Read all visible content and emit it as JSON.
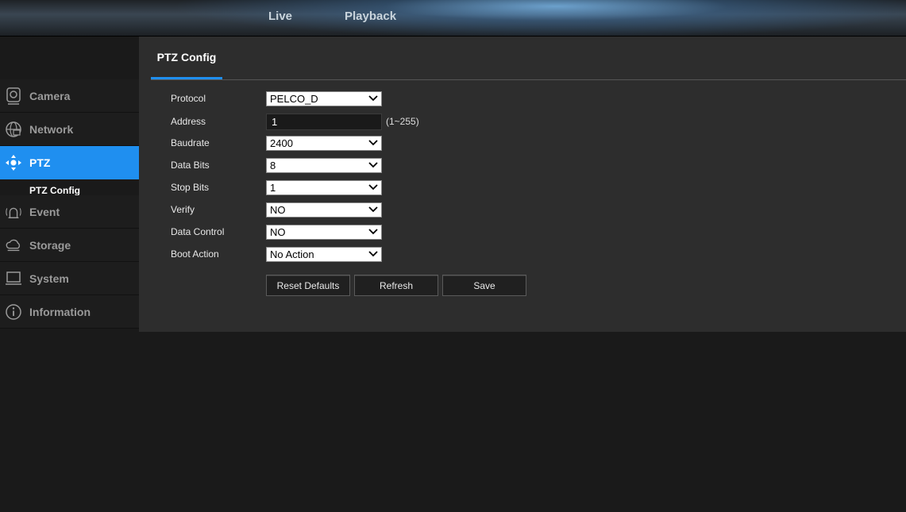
{
  "topnav": {
    "live": "Live",
    "playback": "Playback"
  },
  "sidebar": {
    "items": [
      {
        "label": "Camera",
        "icon": "camera-icon"
      },
      {
        "label": "Network",
        "icon": "network-icon"
      },
      {
        "label": "PTZ",
        "icon": "ptz-icon",
        "active": true
      },
      {
        "label": "Event",
        "icon": "event-icon"
      },
      {
        "label": "Storage",
        "icon": "storage-icon"
      },
      {
        "label": "System",
        "icon": "system-icon"
      },
      {
        "label": "Information",
        "icon": "info-icon"
      }
    ],
    "ptz_sub": "PTZ Config"
  },
  "main": {
    "tab": "PTZ Config",
    "fields": {
      "protocol": {
        "label": "Protocol",
        "value": "PELCO_D"
      },
      "address": {
        "label": "Address",
        "value": "1",
        "hint": "(1~255)"
      },
      "baudrate": {
        "label": "Baudrate",
        "value": "2400"
      },
      "data_bits": {
        "label": "Data Bits",
        "value": "8"
      },
      "stop_bits": {
        "label": "Stop Bits",
        "value": "1"
      },
      "verify": {
        "label": "Verify",
        "value": "NO"
      },
      "data_control": {
        "label": "Data Control",
        "value": "NO"
      },
      "boot_action": {
        "label": "Boot Action",
        "value": "No Action"
      }
    },
    "buttons": {
      "reset": "Reset Defaults",
      "refresh": "Refresh",
      "save": "Save"
    }
  },
  "colors": {
    "accent": "#1f8ff0",
    "panel": "#2d2d2d",
    "background": "#1a1a1a"
  }
}
